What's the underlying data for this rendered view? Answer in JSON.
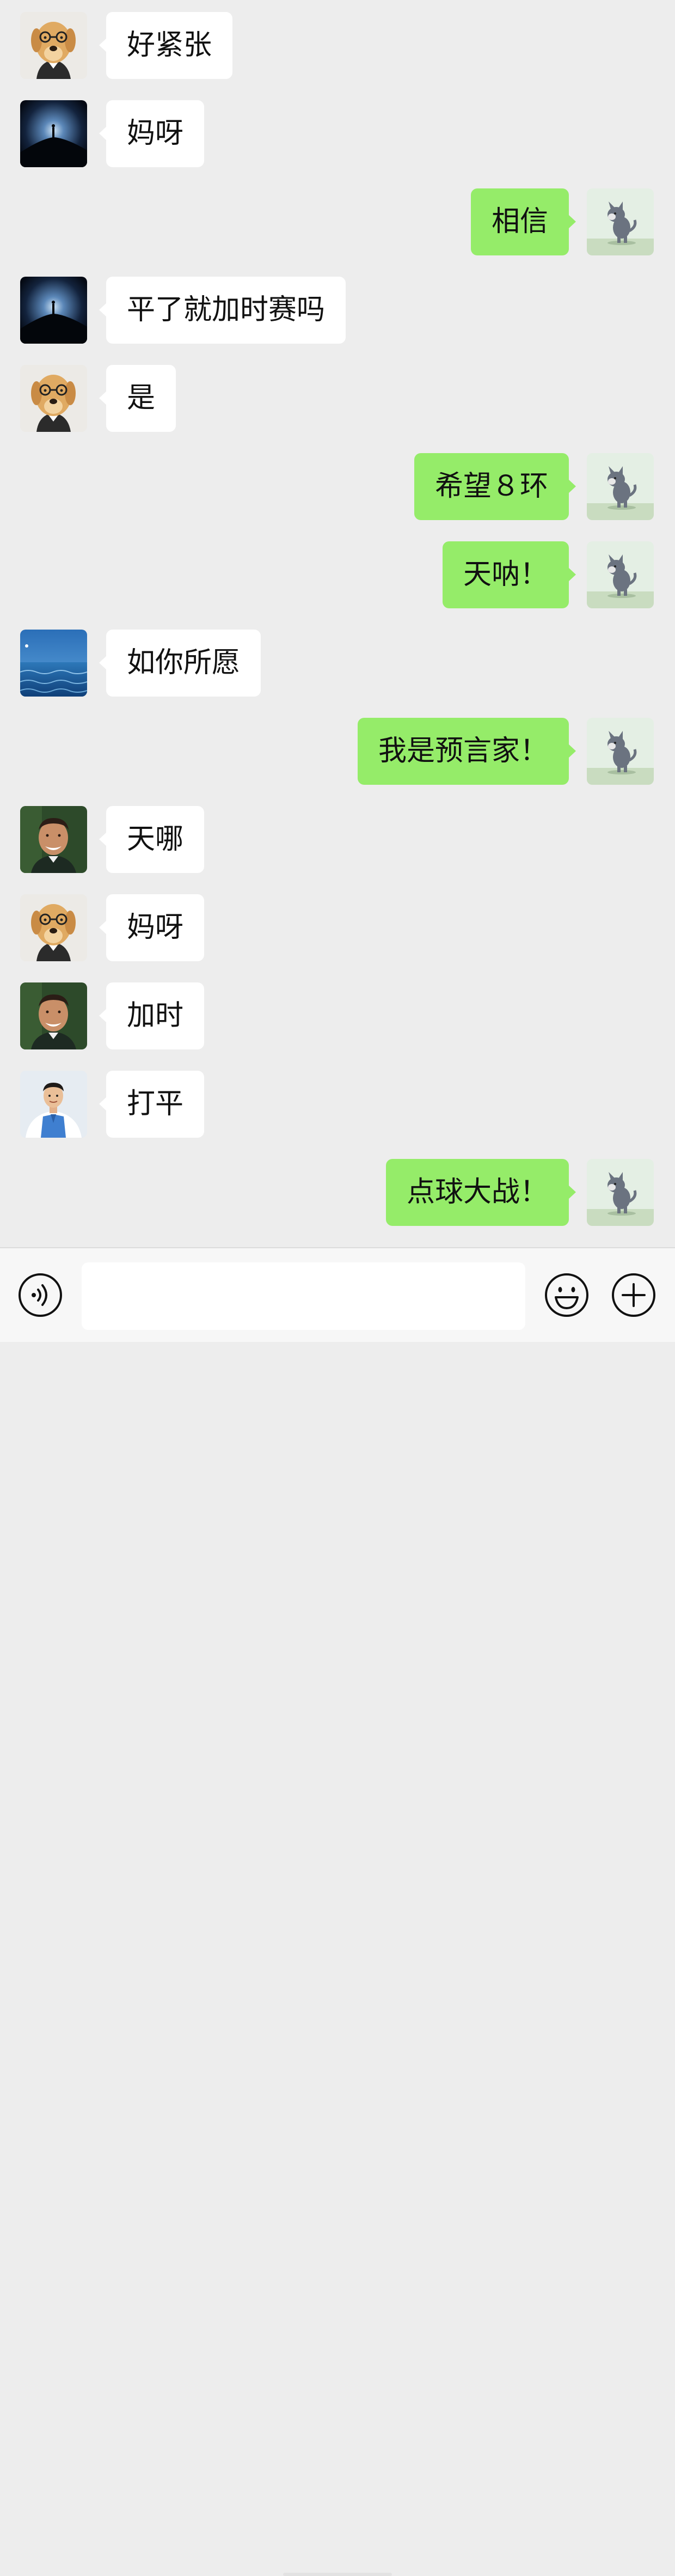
{
  "chat": {
    "messages": [
      {
        "side": "in",
        "avatar": "dog-avatar",
        "text": "好紧张"
      },
      {
        "side": "in",
        "avatar": "hill-avatar",
        "text": "妈呀"
      },
      {
        "side": "out",
        "avatar": "cat-avatar",
        "text": "相信"
      },
      {
        "side": "in",
        "avatar": "hill-avatar",
        "text": "平了就加时赛吗"
      },
      {
        "side": "in",
        "avatar": "dog-avatar",
        "text": "是"
      },
      {
        "side": "out",
        "avatar": "cat-avatar",
        "text": "希望８环"
      },
      {
        "side": "out",
        "avatar": "cat-avatar",
        "text": "天呐！"
      },
      {
        "side": "in",
        "avatar": "ocean-avatar",
        "text": "如你所愿"
      },
      {
        "side": "out",
        "avatar": "cat-avatar",
        "text": "我是预言家！"
      },
      {
        "side": "in",
        "avatar": "man-avatar",
        "text": "天哪"
      },
      {
        "side": "in",
        "avatar": "dog-avatar",
        "text": "妈呀"
      },
      {
        "side": "in",
        "avatar": "man-avatar",
        "text": "加时"
      },
      {
        "side": "in",
        "avatar": "suit-avatar",
        "text": "打平"
      },
      {
        "side": "out",
        "avatar": "cat-avatar",
        "text": "点球大战！"
      }
    ]
  },
  "input_bar": {
    "message_value": "",
    "voice_icon": "voice-icon",
    "emoji_icon": "emoji-icon",
    "plus_icon": "plus-icon"
  },
  "colors": {
    "background": "#ededed",
    "incoming_bubble": "#ffffff",
    "outgoing_bubble": "#95ec69",
    "text": "#111111"
  }
}
